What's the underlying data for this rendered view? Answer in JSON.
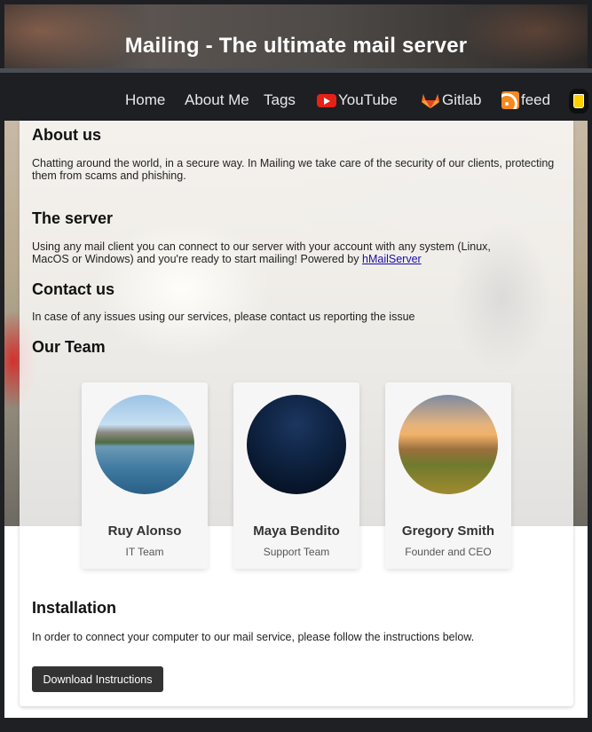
{
  "header": {
    "title": "Mailing - The ultimate mail server"
  },
  "nav": {
    "items": [
      {
        "label": "Home"
      },
      {
        "label": "About Me"
      },
      {
        "label": "Tags"
      },
      {
        "label": "YouTube",
        "icon": "youtube-icon"
      },
      {
        "label": "Gitlab",
        "icon": "gitlab-icon"
      },
      {
        "label": "feed",
        "icon": "rss-icon"
      }
    ],
    "coffee_icon": "coffee-cup-icon"
  },
  "sections": {
    "about": {
      "title": "About us",
      "text": "Chatting around the world, in a secure way. In Mailing we take care of the security of our clients, protecting them from scams and phishing."
    },
    "server": {
      "title": "The server",
      "text": "Using any mail client you can connect to our server with your account with any system (Linux, MacOS or Windows) and you're ready to start mailing! Powered by ",
      "link": "hMailServer"
    },
    "contact": {
      "title": "Contact us",
      "text": "In case of any issues using our services, please contact us reporting the issue"
    },
    "team": {
      "title": "Our Team",
      "members": [
        {
          "name": "Ruy Alonso",
          "role": "IT Team"
        },
        {
          "name": "Maya Bendito",
          "role": "Support Team"
        },
        {
          "name": "Gregory Smith",
          "role": "Founder and CEO"
        }
      ]
    },
    "installation": {
      "title": "Installation",
      "text": "In order to connect your computer to our mail service, please follow the instructions below.",
      "button": "Download Instructions"
    }
  },
  "colors": {
    "nav_bg": "#1d1f23",
    "button_bg": "#333333",
    "link": "#1a0dab"
  }
}
